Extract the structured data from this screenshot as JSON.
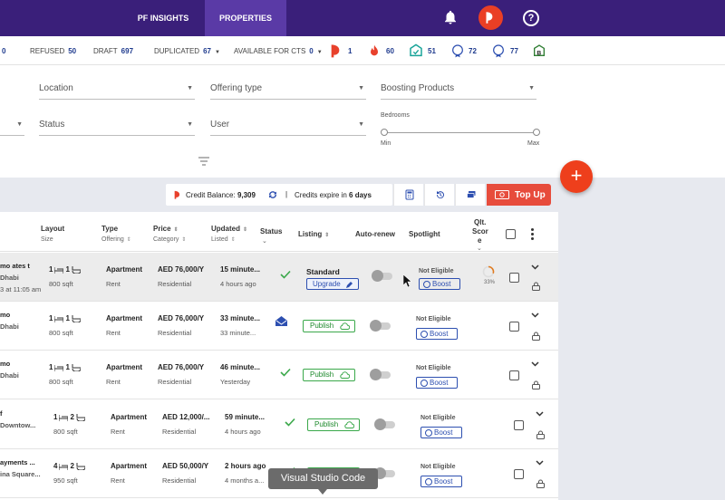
{
  "nav": {
    "tabs": [
      {
        "label": "PF INSIGHTS",
        "active": false
      },
      {
        "label": "PROPERTIES",
        "active": true
      }
    ]
  },
  "stats": {
    "first_count": "0",
    "refused": {
      "label": "REFUSED",
      "count": "50"
    },
    "draft": {
      "label": "DRAFT",
      "count": "697"
    },
    "duplicated": {
      "label": "DUPLICATED",
      "count": "67"
    },
    "available": {
      "label": "AVAILABLE FOR CTS",
      "count": "0"
    },
    "icon_counts": [
      {
        "icon": "pf-logo-icon",
        "count": "1",
        "color": "#e8412c"
      },
      {
        "icon": "flame-icon",
        "count": "60",
        "color": "#e8412c"
      },
      {
        "icon": "verified-home-icon",
        "count": "51",
        "color": "#17a398"
      },
      {
        "icon": "premium-badge-icon",
        "count": "72",
        "color": "#2d4fb0"
      },
      {
        "icon": "featured-badge-icon",
        "count": "77",
        "color": "#2d4fb0"
      },
      {
        "icon": "b-badge-icon",
        "count": "",
        "color": "#2e7d32"
      }
    ]
  },
  "filters": {
    "location": "Location",
    "offering_type": "Offering type",
    "boosting_products": "Boosting Products",
    "status": "Status",
    "user": "User",
    "bedrooms_label": "Bedrooms",
    "min": "Min",
    "max": "Max"
  },
  "credits": {
    "balance_label": "Credit Balance:",
    "balance_value": "9,309",
    "separator": "|",
    "expire_prefix": "Credits expire in",
    "expire_value": "6 days",
    "topup_label": "Top Up"
  },
  "fab_label": "+",
  "table": {
    "headers": {
      "layout": "Layout",
      "layout_sub": "Size",
      "type": "Type",
      "type_sub": "Offering",
      "price": "Price",
      "price_sub": "Category",
      "updated": "Updated",
      "updated_sub": "Listed",
      "status": "Status",
      "listing": "Listing",
      "autorenew": "Auto-renew",
      "spotlight": "Spotlight",
      "qlt1": "Qlt.",
      "qlt2": "Scor",
      "qlt3": "e"
    },
    "rows": [
      {
        "title": "mo ates t",
        "loc": "Dhabi",
        "date": "3 at 11:05 am",
        "beds": "1",
        "baths": "1",
        "size": "800 sqft",
        "type": "Apartment",
        "offering": "Rent",
        "price": "AED 76,000/Y",
        "category": "Residential",
        "updated": "15 minute...",
        "listed": "4 hours ago",
        "status": "check",
        "listing_title": "Standard",
        "listing_btn": "Upgrade",
        "spot_state": "Not Eligible",
        "boost": "Boost",
        "qlt": "33%"
      },
      {
        "title": "mo",
        "loc": "Dhabi",
        "date": "",
        "beds": "1",
        "baths": "1",
        "size": "800 sqft",
        "type": "Apartment",
        "offering": "Rent",
        "price": "AED 76,000/Y",
        "category": "Residential",
        "updated": "33 minute...",
        "listed": "33 minute...",
        "status": "envelope",
        "listing_title": "",
        "listing_btn": "Publish",
        "spot_state": "Not Eligible",
        "boost": "Boost",
        "qlt": ""
      },
      {
        "title": "mo",
        "loc": "Dhabi",
        "date": "",
        "beds": "1",
        "baths": "1",
        "size": "800 sqft",
        "type": "Apartment",
        "offering": "Rent",
        "price": "AED 76,000/Y",
        "category": "Residential",
        "updated": "46 minute...",
        "listed": "Yesterday",
        "status": "check",
        "listing_title": "",
        "listing_btn": "Publish",
        "spot_state": "Not Eligible",
        "boost": "Boost",
        "qlt": ""
      },
      {
        "title": "f",
        "loc": "Downtow...",
        "date": "",
        "beds": "1",
        "baths": "2",
        "size": "800 sqft",
        "type": "Apartment",
        "offering": "Rent",
        "price": "AED 12,000/...",
        "category": "Residential",
        "updated": "59 minute...",
        "listed": "4 hours ago",
        "status": "check",
        "listing_title": "",
        "listing_btn": "Publish",
        "spot_state": "Not Eligible",
        "boost": "Boost",
        "qlt": ""
      },
      {
        "title": "ayments ...",
        "loc": "ina Square...",
        "date": "",
        "beds": "4",
        "baths": "2",
        "size": "950 sqft",
        "type": "Apartment",
        "offering": "Rent",
        "price": "AED 50,000/Y",
        "category": "Residential",
        "updated": "2 hours ago",
        "listed": "4 months a...",
        "status": "check",
        "listing_title": "",
        "listing_btn": "Publish",
        "spot_state": "Not Eligible",
        "boost": "Boost",
        "qlt": ""
      }
    ]
  },
  "tooltip": "Visual Studio Code",
  "colors": {
    "nav_bg": "#3a1f7a",
    "nav_active": "#5a3aa6",
    "accent_red": "#e74c3c",
    "link_blue": "#2d4fb0",
    "publish_green": "#3aa84a"
  }
}
